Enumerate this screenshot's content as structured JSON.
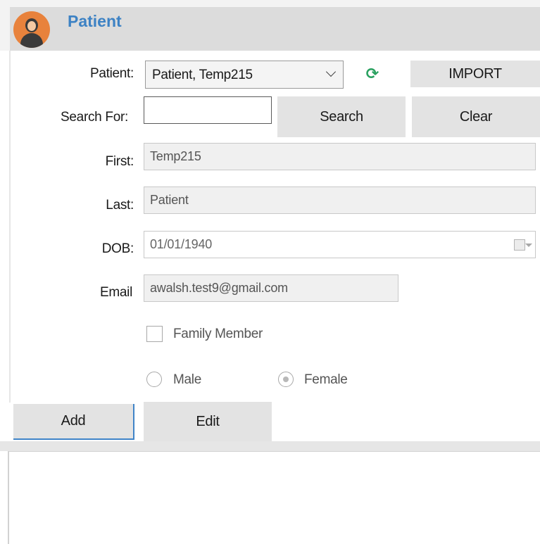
{
  "header": {
    "title": "Patient"
  },
  "form": {
    "patient_label": "Patient:",
    "patient_selected": "Patient, Temp215",
    "import_label": "IMPORT",
    "search_label": "Search For:",
    "search_value": "",
    "search_button": "Search",
    "clear_button": "Clear",
    "first_label": "First:",
    "first_value": "Temp215",
    "last_label": "Last:",
    "last_value": "Patient",
    "dob_label": "DOB:",
    "dob_value": "01/01/1940",
    "email_label": "Email",
    "email_value": "awalsh.test9@gmail.com",
    "family_member_label": "Family Member",
    "family_member_checked": false,
    "gender_options": [
      "Male",
      "Female"
    ],
    "gender_selected": "Female"
  },
  "actions": {
    "add_label": "Add",
    "edit_label": "Edit"
  },
  "colors": {
    "accent": "#3d82c4",
    "avatar": "#e8823c",
    "refresh": "#2aa160"
  },
  "icons": {
    "refresh": "refresh-icon",
    "calendar": "calendar-icon",
    "dropdown": "chevron-down-icon"
  }
}
